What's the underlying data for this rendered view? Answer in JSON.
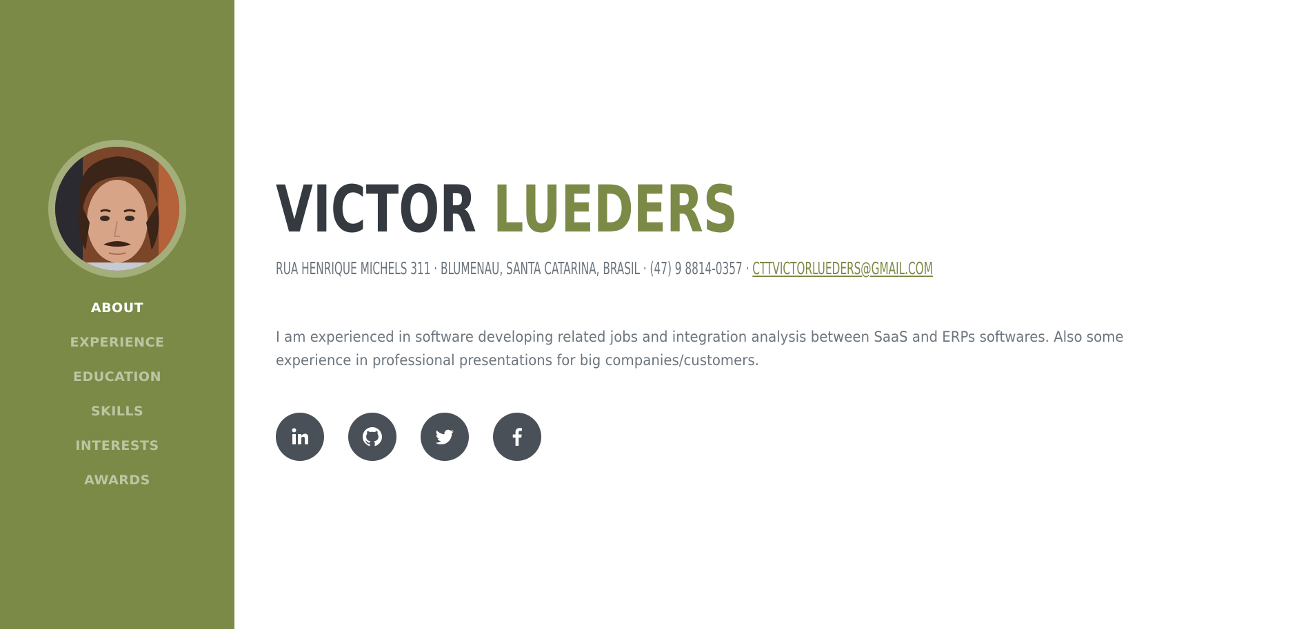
{
  "sidebar": {
    "nav": [
      {
        "label": "ABOUT",
        "active": true
      },
      {
        "label": "EXPERIENCE",
        "active": false
      },
      {
        "label": "EDUCATION",
        "active": false
      },
      {
        "label": "SKILLS",
        "active": false
      },
      {
        "label": "INTERESTS",
        "active": false
      },
      {
        "label": "AWARDS",
        "active": false
      }
    ],
    "bg_color": "#7b8a46"
  },
  "header": {
    "first_name": "VICTOR",
    "last_name": "LUEDERS",
    "contact_text": "RUA HENRIQUE MICHELS 311 · BLUMENAU, SANTA CATARINA, BRASIL · (47) 9 8814-0357 · ",
    "email": "CTTVICTORLUEDERS@GMAIL.COM"
  },
  "bio": "I am experienced in software developing related jobs and integration analysis between SaaS and ERPs softwares. Also some experience in professional presentations for big companies/customers.",
  "socials": [
    {
      "icon": "linkedin-icon"
    },
    {
      "icon": "github-icon"
    },
    {
      "icon": "twitter-icon"
    },
    {
      "icon": "facebook-icon"
    }
  ],
  "colors": {
    "accent": "#7b8a46",
    "heading": "#343a40",
    "muted": "#6c757d",
    "social_bg": "#495057"
  }
}
